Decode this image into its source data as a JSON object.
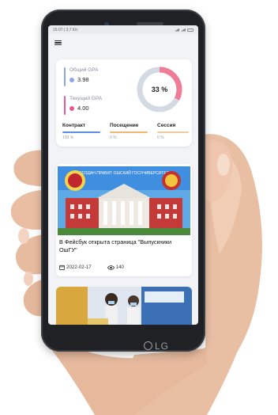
{
  "device": {
    "brand_logo": "LG"
  },
  "statusbar": {
    "time": "16:07 | 3,7 К/с"
  },
  "gpa": {
    "overall_label": "Общий GPA",
    "overall_value": "3.98",
    "current_label": "Текущий GPA",
    "current_value": "4.00",
    "progress_text": "33 %",
    "progress_fraction": 0.33,
    "colors": {
      "ring": "#ef7d98",
      "ring_track": "#d4dae3",
      "overall_dot": "#8da4e8",
      "current_dot": "#e85a8f"
    }
  },
  "tabs": [
    {
      "label": "Контракт",
      "value": "100 %",
      "color": "#5b8def"
    },
    {
      "label": "Посещение",
      "value": "0 %",
      "color": "#f0b770"
    },
    {
      "label": "Сессия",
      "value": "0 %",
      "color": "#f0c9a0"
    }
  ],
  "news": [
    {
      "image_caption": "СОЗДАН ПРАВИТ ОШСКИЙ ГОСУНИВЕРСИТЕТ",
      "title": "В Фейсбук открыта страница \"Выпускники ОшГУ\"",
      "date": "2022-02-17",
      "views": "140"
    }
  ]
}
